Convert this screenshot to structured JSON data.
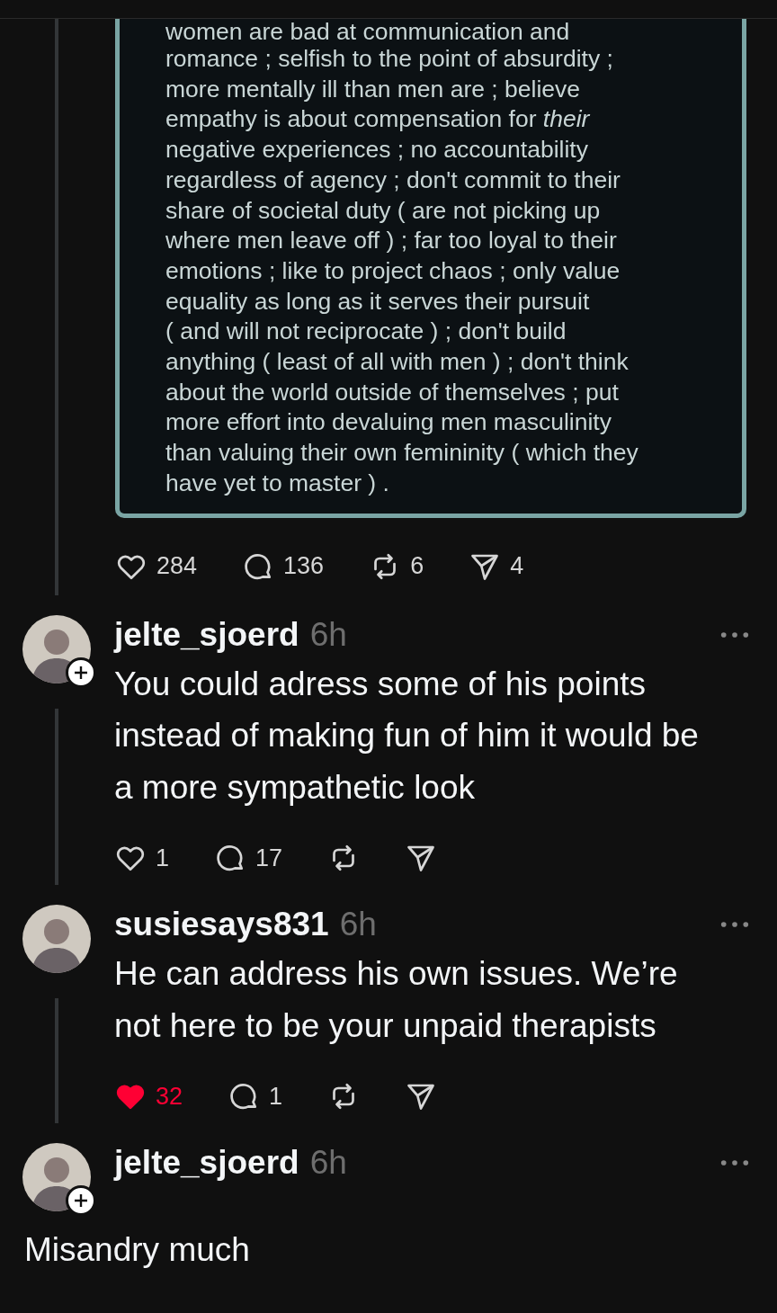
{
  "quoted_post": {
    "lines": [
      "women are bad at communication and",
      "romance ; selfish to the point of absurdity ;",
      "more mentally ill than men are ; believe",
      "empathy is about compensation for *their*",
      "negative experiences ; no accountability",
      "regardless of agency ; don't commit to their",
      "share of societal duty ( are not picking up",
      "where men leave off ) ; far too loyal to their",
      "emotions ; like to project chaos ; only value",
      "equality as long as it serves their pursuit",
      "( and will not reciprocate ) ; don't build",
      "anything ( least of all with men ) ; don't think",
      "about the world outside of themselves ; put",
      "more effort into devaluing men masculinity",
      "than valuing their own femininity ( which they",
      "have yet to master ) ."
    ],
    "actions": {
      "liked": false,
      "likes": "284",
      "replies": "136",
      "reposts": "6",
      "shares": "4"
    }
  },
  "replies": [
    {
      "username": "jelte_sjoerd",
      "time": "6h",
      "follow_badge": true,
      "text": "You could adress some of his points instead of making fun of him it would be a more sympathetic look",
      "actions": {
        "liked": false,
        "likes": "1",
        "replies": "17"
      }
    },
    {
      "username": "susiesays831",
      "time": "6h",
      "follow_badge": false,
      "text": "He can address his own issues. We’re not here to be your unpaid therapists",
      "actions": {
        "liked": true,
        "likes": "32",
        "replies": "1"
      }
    },
    {
      "username": "jelte_sjoerd",
      "time": "6h",
      "follow_badge": true,
      "text": "Misandry much"
    }
  ]
}
